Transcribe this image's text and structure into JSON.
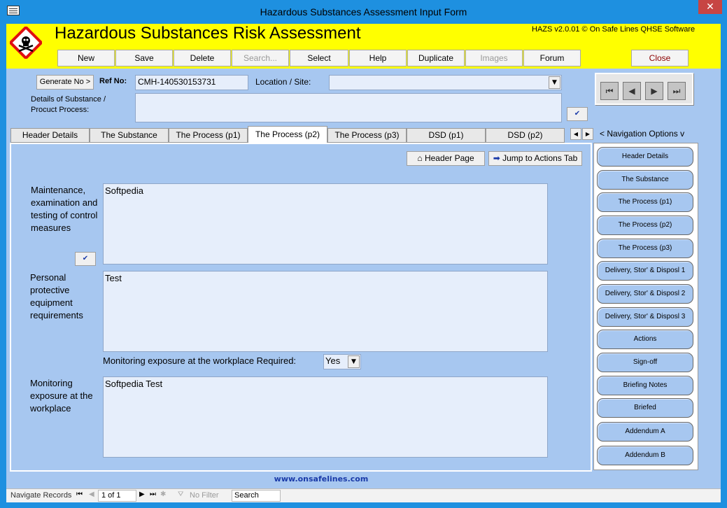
{
  "window": {
    "title": "Hazardous Substances Assessment Input Form",
    "close_glyph": "✕"
  },
  "header": {
    "title": "Hazardous Substances Risk Assessment",
    "version": "HAZS v2.0.01 © On Safe Lines QHSE Software",
    "accent_color": "#ffff00"
  },
  "toolbar": {
    "new": "New",
    "save": "Save",
    "delete": "Delete",
    "search": "Search...",
    "select": "Select",
    "help": "Help",
    "duplicate": "Duplicate",
    "images": "Images",
    "forum": "Forum",
    "close": "Close"
  },
  "form": {
    "generate_label": "Generate No >",
    "ref_label": "Ref No:",
    "ref_value": "CMH-140530153731",
    "location_label": "Location / Site:",
    "location_value": "",
    "details_label": "Details of Substance / Procuct Process:",
    "details_value": ""
  },
  "tabs": [
    {
      "label": "Header Details"
    },
    {
      "label": "The Substance"
    },
    {
      "label": "The Process (p1)"
    },
    {
      "label": "The Process (p2)"
    },
    {
      "label": "The Process (p3)"
    },
    {
      "label": "DSD (p1)"
    },
    {
      "label": "DSD (p2)"
    }
  ],
  "nav_options_label": "< Navigation Options v",
  "tab_buttons": {
    "header_page": "Header Page",
    "jump_actions": "Jump to Actions Tab"
  },
  "fields": {
    "maintenance_label": "Maintenance, examination and testing of control measures",
    "maintenance_value": "Softpedia",
    "ppe_label": "Personal protective equipment requirements",
    "ppe_value": "Test",
    "monitoring_required_label": "Monitoring exposure at the workplace Required:",
    "monitoring_required_value": "Yes",
    "monitoring_label": "Monitoring exposure at the workplace",
    "monitoring_value": "Softpedia Test"
  },
  "navigation": [
    "Header Details",
    "The Substance",
    "The Process (p1)",
    "The Process (p2)",
    "The Process (p3)",
    "Delivery, Stor' & Disposl 1",
    "Delivery, Stor' & Disposl 2",
    "Delivery, Stor' & Disposl 3",
    "Actions",
    "Sign-off",
    "Briefing Notes",
    "Briefed",
    "Addendum A",
    "Addendum B"
  ],
  "footer": {
    "url": "www.onsafelines.com"
  },
  "statusbar": {
    "navigate_label": "Navigate Records",
    "record_text": "1 of 1",
    "filter_label": "No Filter",
    "search_label": "Search"
  }
}
